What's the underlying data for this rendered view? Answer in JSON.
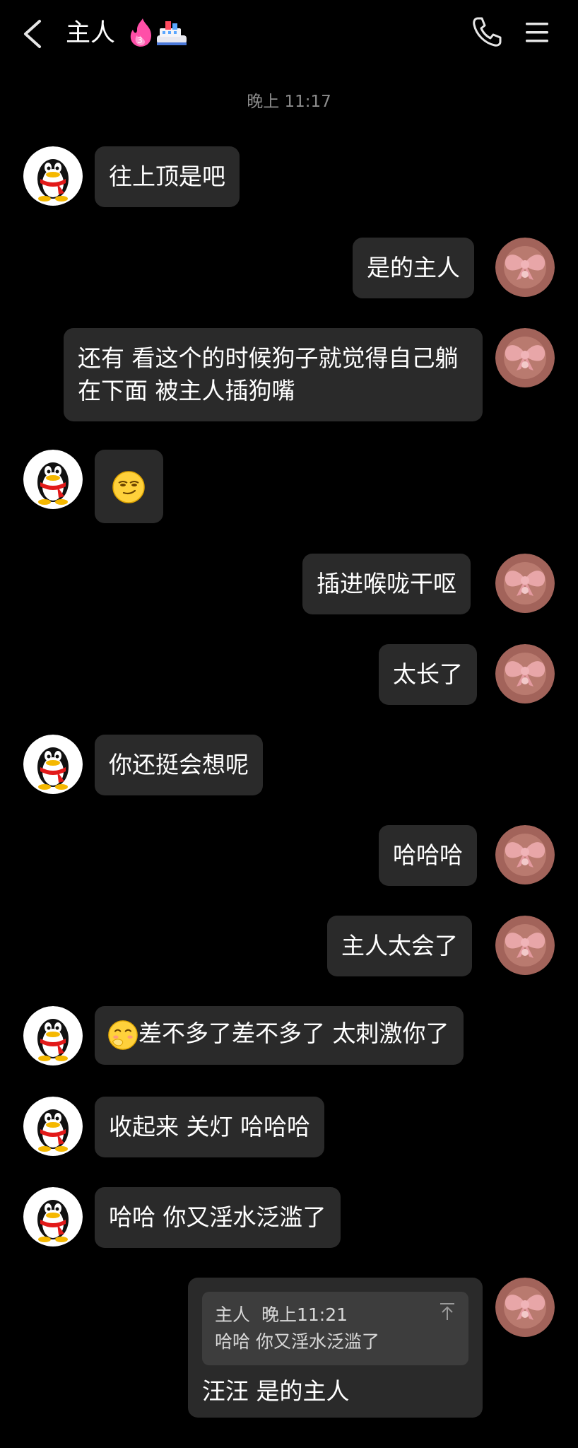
{
  "header": {
    "title": "主人",
    "back_icon": "chevron-left-icon",
    "call_icon": "phone-icon",
    "menu_icon": "hamburger-menu-icon",
    "badge_icons": [
      "flame-badge-icon",
      "ship-badge-icon"
    ],
    "badge_number": "3"
  },
  "timestamp": "晚上 11:17",
  "messages": [
    {
      "side": "left",
      "text": "往上顶是吧"
    },
    {
      "side": "right",
      "text": "是的主人"
    },
    {
      "side": "right",
      "text": "还有 看这个的时候狗子就觉得自己躺在下面 被主人插狗嘴"
    },
    {
      "side": "left",
      "emoji": "smirk-emoji"
    },
    {
      "side": "right",
      "text": "插进喉咙干呕"
    },
    {
      "side": "right",
      "text": "太长了"
    },
    {
      "side": "left",
      "text": "你还挺会想呢"
    },
    {
      "side": "right",
      "text": "哈哈哈"
    },
    {
      "side": "right",
      "text": "主人太会了"
    },
    {
      "side": "left",
      "emoji": "shy-laugh-emoji",
      "text": "差不多了差不多了 太刺激你了"
    },
    {
      "side": "left",
      "text": "收起来 关灯 哈哈哈"
    },
    {
      "side": "left",
      "text": "哈哈 你又淫水泛滥了"
    },
    {
      "side": "right",
      "quote": {
        "sender": "主人",
        "time": "晚上11:21",
        "text": "哈哈 你又淫水泛滥了",
        "icon": "scroll-to-original-icon"
      },
      "text": "汪汪 是的主人"
    }
  ],
  "avatars": {
    "left": "qq-penguin-avatar",
    "right": "pink-bow-avatar"
  },
  "colors": {
    "background": "#000000",
    "bubble": "#2a2a2a",
    "quote": "#3d3d3d",
    "timestamp": "#8c8c8c"
  }
}
